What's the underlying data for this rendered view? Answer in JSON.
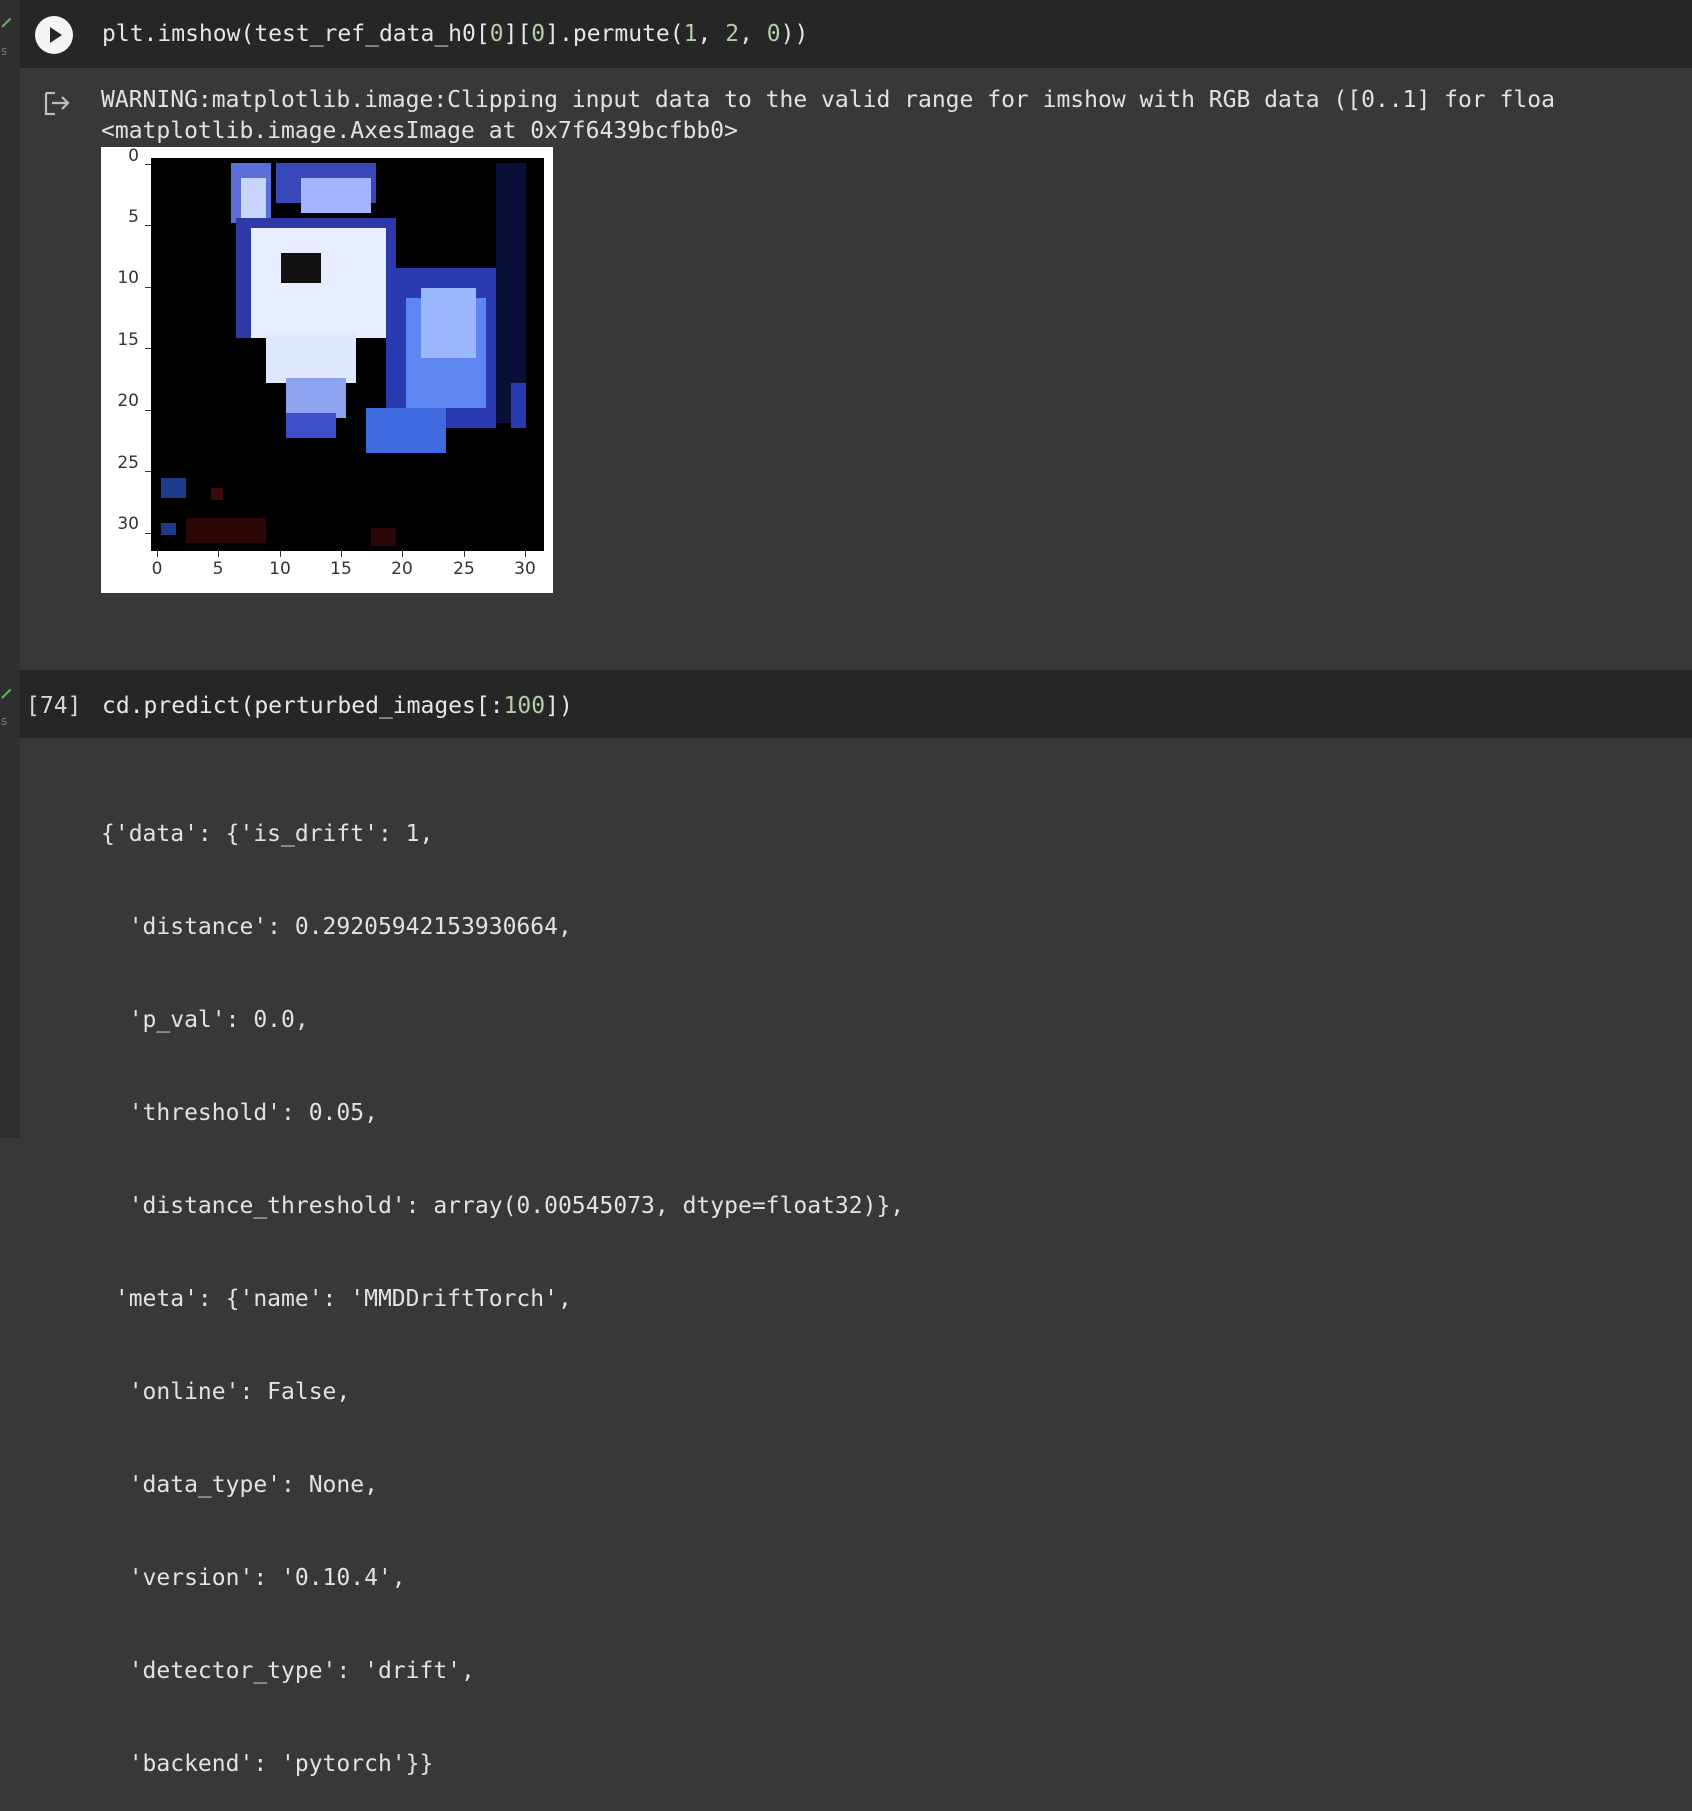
{
  "cell1": {
    "code_parts": [
      "plt.imshow(test_ref_data_h0[",
      "0",
      "][",
      "0",
      "].permute(",
      "1",
      ", ",
      "2",
      ", ",
      "0",
      "))"
    ],
    "output_warning": "WARNING:matplotlib.image:Clipping input data to the valid range for imshow with RGB data ([0..1] for floa",
    "output_repr": "<matplotlib.image.AxesImage at 0x7f6439bcfbb0>",
    "figure": {
      "y_ticks": [
        "0",
        "5",
        "10",
        "15",
        "20",
        "25",
        "30"
      ],
      "x_ticks": [
        "0",
        "5",
        "10",
        "15",
        "20",
        "25",
        "30"
      ]
    }
  },
  "cell2": {
    "exec_count": "[74]",
    "code_parts": [
      "cd.predict(perturbed_images[:",
      "100",
      "])"
    ],
    "output_lines": [
      "{'data': {'is_drift': 1,",
      "  'distance': 0.29205942153930664,",
      "  'p_val': 0.0,",
      "  'threshold': 0.05,",
      "  'distance_threshold': array(0.00545073, dtype=float32)},",
      " 'meta': {'name': 'MMDDriftTorch',",
      "  'online': False,",
      "  'data_type': None,",
      "  'version': '0.10.4',",
      "  'detector_type': 'drift',",
      "  'backend': 'pytorch'}}"
    ]
  },
  "gutter": {
    "status_mark": "s"
  },
  "icons": {
    "run": "play-circle-icon",
    "output": "output-redirect-icon",
    "done": "check-icon"
  }
}
